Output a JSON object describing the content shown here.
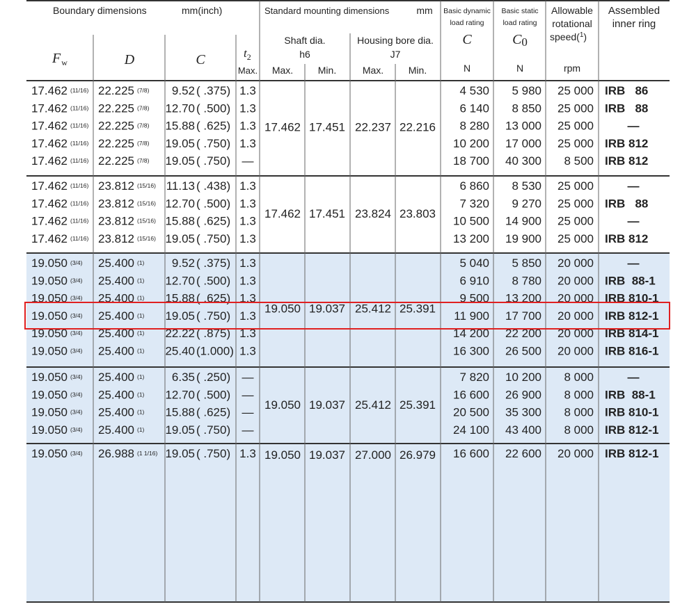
{
  "header": {
    "boundary_title": "Boundary dimensions",
    "boundary_unit": "mm(inch)",
    "fw_symbol": "F",
    "fw_sub": "w",
    "d_symbol": "D",
    "c_symbol": "C",
    "t2_symbol": "t",
    "t2_sub": "2",
    "t2_max": "Max.",
    "mounting_title": "Standard mounting dimensions",
    "mounting_unit": "mm",
    "shaft_title": "Shaft dia.",
    "shaft_tol": "h6",
    "shaft_max": "Max.",
    "shaft_min": "Min.",
    "housing_title": "Housing bore dia.",
    "housing_tol": "J7",
    "housing_max": "Max.",
    "housing_min": "Min.",
    "dyn_line1": "Basic dynamic",
    "dyn_line2": "load rating",
    "dyn_symbol": "C",
    "dyn_unit": "N",
    "static_line1": "Basic static",
    "static_line2": "load rating",
    "static_symbol": "C",
    "static_sub": "0",
    "static_unit": "N",
    "speed_line1": "Allowable",
    "speed_line2": "rotational",
    "speed_line3": "speed(",
    "speed_note": "1",
    "speed_close": ")",
    "speed_unit": "rpm",
    "inner_line1": "Assembled",
    "inner_line2": "inner ring"
  },
  "groups": [
    {
      "mount": {
        "shaft_max": "17.462",
        "shaft_min": "17.451",
        "housing_max": "22.237",
        "housing_min": "22.216"
      },
      "rows": [
        {
          "fw": "17.462",
          "fw_frac": "11/16",
          "d": "22.225",
          "d_frac": "7/8",
          "c": "9.52",
          "c_in": "( .375)",
          "t2": "1.3",
          "dyn": "4 530",
          "stat": "5 980",
          "speed": "25 000",
          "inner": "IRB   86"
        },
        {
          "fw": "17.462",
          "fw_frac": "11/16",
          "d": "22.225",
          "d_frac": "7/8",
          "c": "12.70",
          "c_in": "( .500)",
          "t2": "1.3",
          "dyn": "6 140",
          "stat": "8 850",
          "speed": "25 000",
          "inner": "IRB   88"
        },
        {
          "fw": "17.462",
          "fw_frac": "11/16",
          "d": "22.225",
          "d_frac": "7/8",
          "c": "15.88",
          "c_in": "( .625)",
          "t2": "1.3",
          "dyn": "8 280",
          "stat": "13 000",
          "speed": "25 000",
          "inner": "—"
        },
        {
          "fw": "17.462",
          "fw_frac": "11/16",
          "d": "22.225",
          "d_frac": "7/8",
          "c": "19.05",
          "c_in": "( .750)",
          "t2": "1.3",
          "dyn": "10 200",
          "stat": "17 000",
          "speed": "25 000",
          "inner": "IRB 812"
        },
        {
          "fw": "17.462",
          "fw_frac": "11/16",
          "d": "22.225",
          "d_frac": "7/8",
          "c": "19.05",
          "c_in": "( .750)",
          "t2": "—",
          "dyn": "18 700",
          "stat": "40 300",
          "speed": "8 500",
          "inner": "IRB 812"
        }
      ]
    },
    {
      "mount": {
        "shaft_max": "17.462",
        "shaft_min": "17.451",
        "housing_max": "23.824",
        "housing_min": "23.803"
      },
      "rows": [
        {
          "fw": "17.462",
          "fw_frac": "11/16",
          "d": "23.812",
          "d_frac": "15/16",
          "c": "11.13",
          "c_in": "( .438)",
          "t2": "1.3",
          "dyn": "6 860",
          "stat": "8 530",
          "speed": "25 000",
          "inner": "—"
        },
        {
          "fw": "17.462",
          "fw_frac": "11/16",
          "d": "23.812",
          "d_frac": "15/16",
          "c": "12.70",
          "c_in": "( .500)",
          "t2": "1.3",
          "dyn": "7 320",
          "stat": "9 270",
          "speed": "25 000",
          "inner": "IRB   88"
        },
        {
          "fw": "17.462",
          "fw_frac": "11/16",
          "d": "23.812",
          "d_frac": "15/16",
          "c": "15.88",
          "c_in": "( .625)",
          "t2": "1.3",
          "dyn": "10 500",
          "stat": "14 900",
          "speed": "25 000",
          "inner": "—"
        },
        {
          "fw": "17.462",
          "fw_frac": "11/16",
          "d": "23.812",
          "d_frac": "15/16",
          "c": "19.05",
          "c_in": "( .750)",
          "t2": "1.3",
          "dyn": "13 200",
          "stat": "19 900",
          "speed": "25 000",
          "inner": "IRB 812"
        }
      ]
    },
    {
      "mount": {
        "shaft_max": "19.050",
        "shaft_min": "19.037",
        "housing_max": "25.412",
        "housing_min": "25.391"
      },
      "rows": [
        {
          "fw": "19.050",
          "fw_frac": "3/4",
          "d": "25.400",
          "d_frac": "1",
          "c": "9.52",
          "c_in": "( .375)",
          "t2": "1.3",
          "dyn": "5 040",
          "stat": "5 850",
          "speed": "20 000",
          "inner": "—"
        },
        {
          "fw": "19.050",
          "fw_frac": "3/4",
          "d": "25.400",
          "d_frac": "1",
          "c": "12.70",
          "c_in": "( .500)",
          "t2": "1.3",
          "dyn": "6 910",
          "stat": "8 780",
          "speed": "20 000",
          "inner": "IRB  88-1"
        },
        {
          "fw": "19.050",
          "fw_frac": "3/4",
          "d": "25.400",
          "d_frac": "1",
          "c": "15.88",
          "c_in": "( .625)",
          "t2": "1.3",
          "dyn": "9 500",
          "stat": "13 200",
          "speed": "20 000",
          "inner": "IRB 810-1"
        },
        {
          "fw": "19.050",
          "fw_frac": "3/4",
          "d": "25.400",
          "d_frac": "1",
          "c": "19.05",
          "c_in": "( .750)",
          "t2": "1.3",
          "dyn": "11 900",
          "stat": "17 700",
          "speed": "20 000",
          "inner": "IRB 812-1"
        },
        {
          "fw": "19.050",
          "fw_frac": "3/4",
          "d": "25.400",
          "d_frac": "1",
          "c": "22.22",
          "c_in": "( .875)",
          "t2": "1.3",
          "dyn": "14 200",
          "stat": "22 200",
          "speed": "20 000",
          "inner": "IRB 814-1"
        },
        {
          "fw": "19.050",
          "fw_frac": "3/4",
          "d": "25.400",
          "d_frac": "1",
          "c": "25.40",
          "c_in": "(1.000)",
          "t2": "1.3",
          "dyn": "16 300",
          "stat": "26 500",
          "speed": "20 000",
          "inner": "IRB 816-1"
        }
      ]
    },
    {
      "mount": {
        "shaft_max": "19.050",
        "shaft_min": "19.037",
        "housing_max": "25.412",
        "housing_min": "25.391"
      },
      "rows": [
        {
          "fw": "19.050",
          "fw_frac": "3/4",
          "d": "25.400",
          "d_frac": "1",
          "c": "6.35",
          "c_in": "( .250)",
          "t2": "—",
          "dyn": "7 820",
          "stat": "10 200",
          "speed": "8 000",
          "inner": "—"
        },
        {
          "fw": "19.050",
          "fw_frac": "3/4",
          "d": "25.400",
          "d_frac": "1",
          "c": "12.70",
          "c_in": "( .500)",
          "t2": "—",
          "dyn": "16 600",
          "stat": "26 900",
          "speed": "8 000",
          "inner": "IRB  88-1"
        },
        {
          "fw": "19.050",
          "fw_frac": "3/4",
          "d": "25.400",
          "d_frac": "1",
          "c": "15.88",
          "c_in": "( .625)",
          "t2": "—",
          "dyn": "20 500",
          "stat": "35 300",
          "speed": "8 000",
          "inner": "IRB 810-1"
        },
        {
          "fw": "19.050",
          "fw_frac": "3/4",
          "d": "25.400",
          "d_frac": "1",
          "c": "19.05",
          "c_in": "( .750)",
          "t2": "—",
          "dyn": "24 100",
          "stat": "43 400",
          "speed": "8 000",
          "inner": "IRB 812-1"
        }
      ]
    },
    {
      "mount": {
        "shaft_max": "19.050",
        "shaft_min": "19.037",
        "housing_max": "27.000",
        "housing_min": "26.979"
      },
      "rows": [
        {
          "fw": "19.050",
          "fw_frac": "3/4",
          "d": "26.988",
          "d_frac": "1 1/16",
          "c": "19.05",
          "c_in": "( .750)",
          "t2": "1.3",
          "dyn": "16 600",
          "stat": "22 600",
          "speed": "20 000",
          "inner": "IRB 812-1"
        }
      ]
    }
  ],
  "colors": {
    "shaded_band": "#dde9f6",
    "header_fill": "#ffffff",
    "highlight_box": "#e02020",
    "rule": "#333333",
    "grid": "#666666"
  }
}
